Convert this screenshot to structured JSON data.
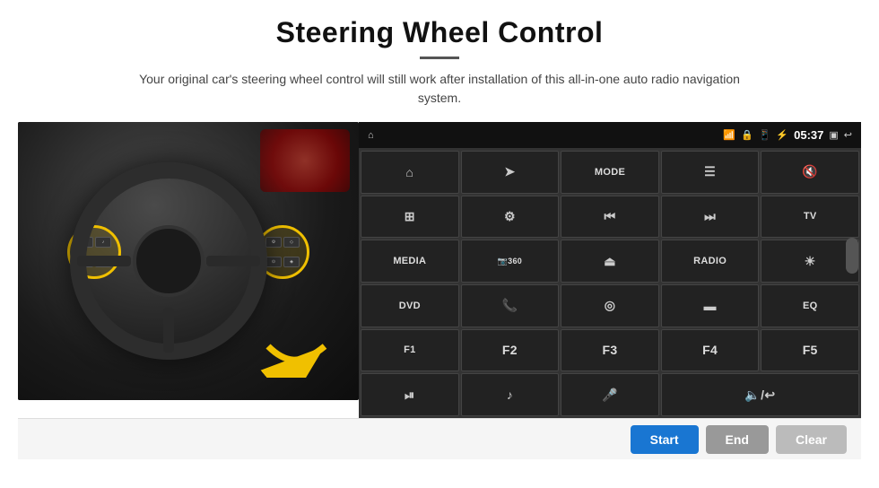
{
  "header": {
    "title": "Steering Wheel Control",
    "subtitle": "Your original car's steering wheel control will still work after installation of this all-in-one auto radio navigation system."
  },
  "statusBar": {
    "time": "05:37",
    "icons": [
      "wifi",
      "lock",
      "sim",
      "bluetooth",
      "battery",
      "screen",
      "back"
    ]
  },
  "gridButtons": [
    {
      "id": "nav",
      "icon": "⌂",
      "text": "",
      "row": 1,
      "col": 1
    },
    {
      "id": "send",
      "icon": "➤",
      "text": "",
      "row": 1,
      "col": 2
    },
    {
      "id": "mode",
      "icon": "",
      "text": "MODE",
      "row": 1,
      "col": 3
    },
    {
      "id": "list",
      "icon": "☰",
      "text": "",
      "row": 1,
      "col": 4
    },
    {
      "id": "mute",
      "icon": "🔇",
      "text": "",
      "row": 1,
      "col": 5
    },
    {
      "id": "apps",
      "icon": "⊞",
      "text": "",
      "row": 1,
      "col": 6
    },
    {
      "id": "settings",
      "icon": "⚙",
      "text": "",
      "row": 2,
      "col": 1
    },
    {
      "id": "prev",
      "icon": "⏮",
      "text": "",
      "row": 2,
      "col": 2
    },
    {
      "id": "next",
      "icon": "⏭",
      "text": "",
      "row": 2,
      "col": 3
    },
    {
      "id": "tv",
      "icon": "",
      "text": "TV",
      "row": 2,
      "col": 4
    },
    {
      "id": "media",
      "icon": "",
      "text": "MEDIA",
      "row": 2,
      "col": 5
    },
    {
      "id": "camera360",
      "icon": "📷",
      "text": "360",
      "row": 3,
      "col": 1
    },
    {
      "id": "eject",
      "icon": "⏏",
      "text": "",
      "row": 3,
      "col": 2
    },
    {
      "id": "radio",
      "icon": "",
      "text": "RADIO",
      "row": 3,
      "col": 3
    },
    {
      "id": "brightness",
      "icon": "☀",
      "text": "",
      "row": 3,
      "col": 4
    },
    {
      "id": "dvd",
      "icon": "",
      "text": "DVD",
      "row": 3,
      "col": 5
    },
    {
      "id": "phone",
      "icon": "📞",
      "text": "",
      "row": 4,
      "col": 1
    },
    {
      "id": "nav2",
      "icon": "◎",
      "text": "",
      "row": 4,
      "col": 2
    },
    {
      "id": "screen",
      "icon": "▬",
      "text": "",
      "row": 4,
      "col": 3
    },
    {
      "id": "eq",
      "icon": "",
      "text": "EQ",
      "row": 4,
      "col": 4
    },
    {
      "id": "f1",
      "icon": "",
      "text": "F1",
      "row": 4,
      "col": 5
    },
    {
      "id": "f2",
      "icon": "",
      "text": "F2",
      "row": 5,
      "col": 1
    },
    {
      "id": "f3",
      "icon": "",
      "text": "F3",
      "row": 5,
      "col": 2
    },
    {
      "id": "f4",
      "icon": "",
      "text": "F4",
      "row": 5,
      "col": 3
    },
    {
      "id": "f5",
      "icon": "",
      "text": "F5",
      "row": 5,
      "col": 4
    },
    {
      "id": "playpause",
      "icon": "⏯",
      "text": "",
      "row": 5,
      "col": 5
    },
    {
      "id": "music",
      "icon": "♪",
      "text": "",
      "row": 6,
      "col": 1
    },
    {
      "id": "mic",
      "icon": "🎤",
      "text": "",
      "row": 6,
      "col": 2
    },
    {
      "id": "volume",
      "icon": "🔈",
      "text": "",
      "row": 6,
      "col": 3
    }
  ],
  "bottomBar": {
    "startLabel": "Start",
    "endLabel": "End",
    "clearLabel": "Clear"
  }
}
